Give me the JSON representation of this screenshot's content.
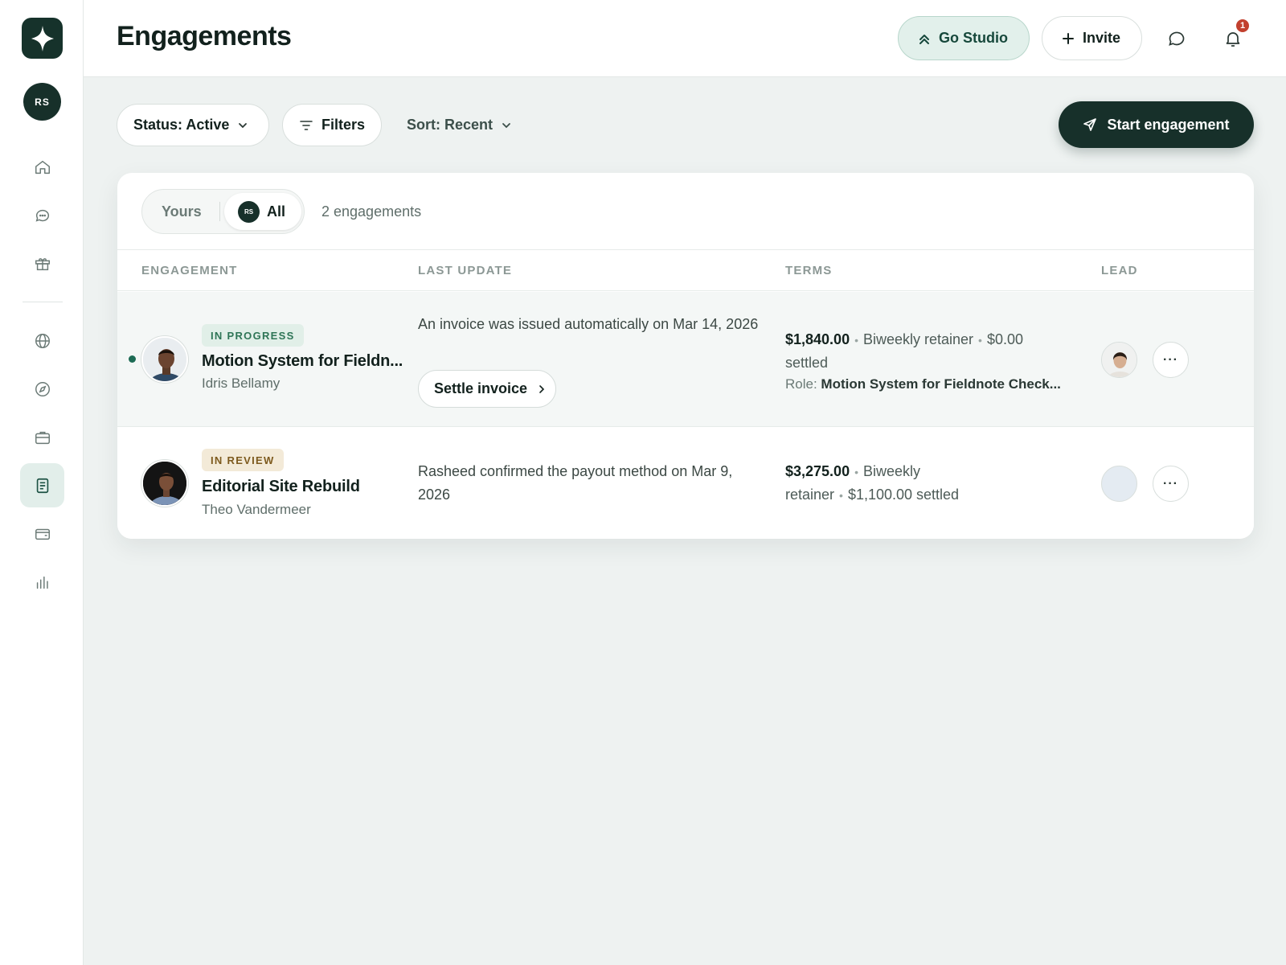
{
  "sidebar": {
    "logo_icon": "sparkle-icon",
    "user_initials": "RS",
    "items": [
      {
        "icon": "home-icon",
        "active": false
      },
      {
        "icon": "chat-icon",
        "active": false
      },
      {
        "icon": "gift-icon",
        "active": false
      },
      {
        "icon": "globe-icon",
        "active": false
      },
      {
        "icon": "compass-icon",
        "active": false
      },
      {
        "icon": "briefcase-icon",
        "active": false
      },
      {
        "icon": "document-icon",
        "active": true
      },
      {
        "icon": "wallet-icon",
        "active": false
      },
      {
        "icon": "chart-icon",
        "active": false
      }
    ]
  },
  "header": {
    "title": "Engagements",
    "studio_label": "Go Studio",
    "invite_label": "Invite",
    "notification_count": "1"
  },
  "toolbar": {
    "status_label": "Status: Active",
    "filters_label": "Filters",
    "sort_label": "Sort: Recent",
    "start_label": "Start engagement"
  },
  "card": {
    "scope_yours": "Yours",
    "scope_all": "All",
    "scope_all_initials": "RS",
    "count_text": "2 engagements",
    "columns": [
      "ENGAGEMENT",
      "LAST UPDATE",
      "TERMS",
      "LEAD"
    ],
    "rows": [
      {
        "status": "IN PROGRESS",
        "title": "Motion System for Fieldn...",
        "client": "Idris Bellamy",
        "update": "An invoice was issued automatically on Mar 14, 2026",
        "action_label": "Settle invoice",
        "amount": "$1,840.00",
        "cadence": "Biweekly retainer",
        "settled": "$0.00 settled",
        "role_label": "Role:",
        "role_value": "Motion System for Fieldnote Check...",
        "more_label": "···"
      },
      {
        "status": "IN REVIEW",
        "title": "Editorial Site Rebuild",
        "client": "Theo Vandermeer",
        "update": "Rasheed confirmed the payout method on Mar 9, 2026",
        "amount": "$3,275.00",
        "cadence": "Biweekly retainer",
        "settled": "$1,100.00 settled",
        "more_label": "···"
      }
    ]
  },
  "colors": {
    "brand_dark": "#17302a",
    "accent_green": "#2e7556",
    "notification_red": "#c2402e"
  }
}
